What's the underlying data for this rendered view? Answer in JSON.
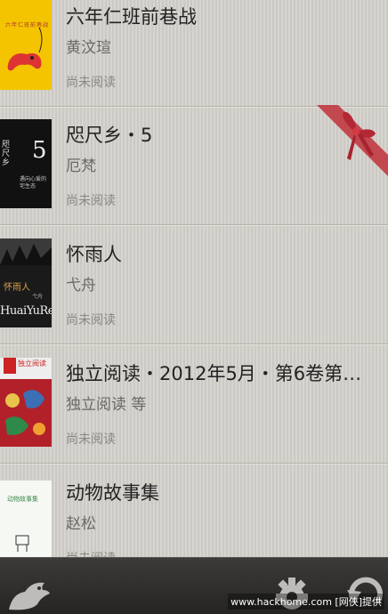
{
  "books": [
    {
      "title": "六年仁班前巷战",
      "author": "黄汶瑄",
      "status": "尚未阅读",
      "cover_text": "六年仁班前巷战",
      "cover_color": "#f4c400"
    },
    {
      "title": "咫尺乡・5",
      "author": "厄梵",
      "status": "尚未阅读",
      "cover_text_a": "咫尺乡",
      "cover_number": "5",
      "cover_text_b": "遇向心爱的 宅生态",
      "has_gift_ribbon": true
    },
    {
      "title": "怀雨人",
      "author": "弋舟",
      "status": "尚未阅读",
      "cover_text_a": "怀雨人",
      "cover_text_b": "弋舟",
      "cover_text_c": "HuaiYuRen"
    },
    {
      "title": "独立阅读・2012年5月・第6卷第…",
      "author": "独立阅读 等",
      "status": "尚未阅读",
      "cover_text": "独立阅读"
    },
    {
      "title": "动物故事集",
      "author": "赵松",
      "status": "尚未阅读",
      "cover_text": "动物故事集"
    }
  ],
  "toolbar": {
    "left_icon": "bird-icon",
    "settings_icon": "gear-icon",
    "refresh_icon": "refresh-icon"
  },
  "watermark": "www.hackhome.com [网侠]提供",
  "colors": {
    "ribbon": "#c0303a",
    "toolbar": "#2e2d2b",
    "background": "#d3d0cb"
  }
}
